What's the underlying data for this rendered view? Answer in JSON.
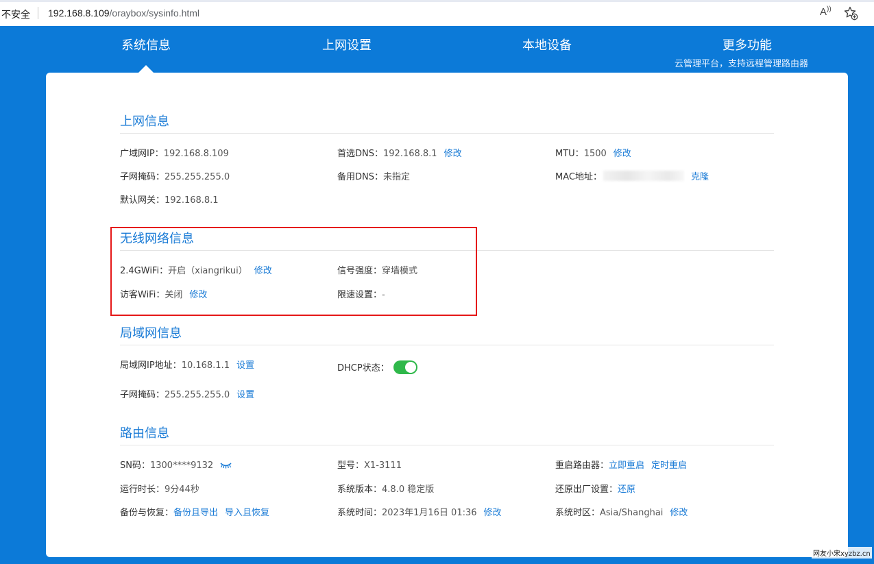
{
  "browser": {
    "security_label": "不安全",
    "url_host": "192.168.8.109",
    "url_path": "/oraybox/sysinfo.html",
    "read_aloud_glyph": "Aᴬ",
    "favorites_icon": "star-plus-icon"
  },
  "nav": {
    "items": [
      {
        "label": "系统信息",
        "active": true
      },
      {
        "label": "上网设置"
      },
      {
        "label": "本地设备"
      },
      {
        "label": "更多功能"
      }
    ],
    "more_subtitle": "云管理平台，支持远程管理路由器"
  },
  "colors": {
    "brand_blue": "#0c7ad8",
    "link_blue": "#1a7bd6",
    "toggle_on": "#2fb84a",
    "highlight_red": "#e51717"
  },
  "internet": {
    "title": "上网信息",
    "wan_ip_label": "广域网IP：",
    "wan_ip": "192.168.8.109",
    "dns1_label": "首选DNS：",
    "dns1": "192.168.8.1",
    "dns1_action": "修改",
    "mtu_label": "MTU：",
    "mtu": "1500",
    "mtu_action": "修改",
    "mask_label": "子网掩码：",
    "mask": "255.255.255.0",
    "dns2_label": "备用DNS：",
    "dns2": "未指定",
    "mac_label": "MAC地址：",
    "mac_action": "克隆",
    "gateway_label": "默认网关：",
    "gateway": "192.168.8.1"
  },
  "wireless": {
    "title": "无线网络信息",
    "wifi24_label": "2.4GWiFi：",
    "wifi24_value": "开启（xiangrikui）",
    "wifi24_action": "修改",
    "signal_label": "信号强度：",
    "signal_value": "穿墙模式",
    "guest_label": "访客WiFi：",
    "guest_value": "关闭",
    "guest_action": "修改",
    "limit_label": "限速设置：",
    "limit_value": "-"
  },
  "lan": {
    "title": "局域网信息",
    "ip_label": "局域网IP地址：",
    "ip": "10.168.1.1",
    "ip_action": "设置",
    "dhcp_label": "DHCP状态：",
    "dhcp_enabled": true,
    "mask_label": "子网掩码：",
    "mask": "255.255.255.0",
    "mask_action": "设置"
  },
  "router": {
    "title": "路由信息",
    "sn_label": "SN码：",
    "sn": "1300****9132",
    "sn_icon": "eye-closed-icon",
    "model_label": "型号：",
    "model": "X1-3111",
    "reboot_label": "重启路由器：",
    "reboot_now": "立即重启",
    "reboot_scheduled": "定时重启",
    "uptime_label": "运行时长：",
    "uptime": "9分44秒",
    "version_label": "系统版本：",
    "version": "4.8.0 稳定版",
    "factory_label": "还原出厂设置：",
    "factory_action": "还原",
    "backup_label": "备份与恢复：",
    "backup_export": "备份且导出",
    "backup_import": "导入且恢复",
    "time_label": "系统时间：",
    "time": "2023年1月16日 01:36",
    "time_action": "修改",
    "tz_label": "系统时区：",
    "tz": "Asia/Shanghai",
    "tz_action": "修改"
  },
  "watermark": "网友小宋xyzbz.cn"
}
